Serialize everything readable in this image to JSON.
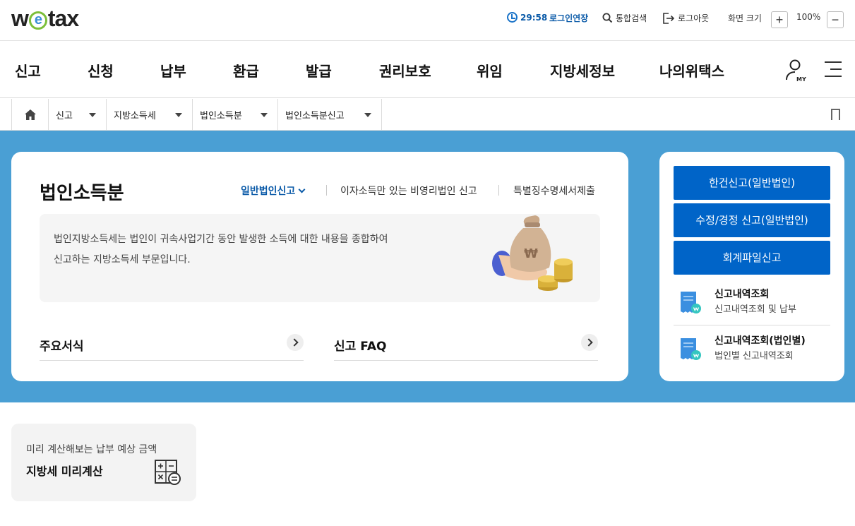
{
  "header": {
    "logo": "wetax",
    "timer": "29:58",
    "extend_login": "로그인연장",
    "search": "통합검색",
    "logout": "로그아웃",
    "zoom_label": "화면 크기",
    "zoom_plus": "+",
    "zoom_value": "100%",
    "zoom_minus": "−"
  },
  "gnb": {
    "items": [
      "신고",
      "신청",
      "납부",
      "환급",
      "발급",
      "권리보호",
      "위임",
      "지방세정보",
      "나의위택스"
    ],
    "my_label": "MY"
  },
  "breadcrumb": [
    "신고",
    "지방소득세",
    "법인소득분",
    "법인소득분신고"
  ],
  "main": {
    "title": "법인소득분",
    "tabs": [
      "일반법인신고",
      "이자소득만 있는 비영리법인 신고",
      "특별징수명세서제출"
    ],
    "description": "법인지방소득세는 법인이 귀속사업기간 동안 발생한 소득에 대한 내용을 종합하여 신고하는 지방소득세 부문입니다.",
    "illustration_symbol": "₩",
    "links": [
      "주요서식",
      "신고 FAQ"
    ]
  },
  "side": {
    "buttons": [
      "한건신고(일반법인)",
      "수정/경정 신고(일반법인)",
      "회계파일신고"
    ],
    "links": [
      {
        "title": "신고내역조회",
        "sub": "신고내역조회 및 납부"
      },
      {
        "title": "신고내역조회(법인별)",
        "sub": "법인별 신고내역조회"
      }
    ]
  },
  "calc": {
    "sub": "미리 계산해보는 납부 예상 금액",
    "title": "지방세 미리계산"
  },
  "colors": {
    "primary": "#0064c8",
    "hero_bg": "#4a9fd4",
    "accent_text": "#0a5aa8"
  }
}
